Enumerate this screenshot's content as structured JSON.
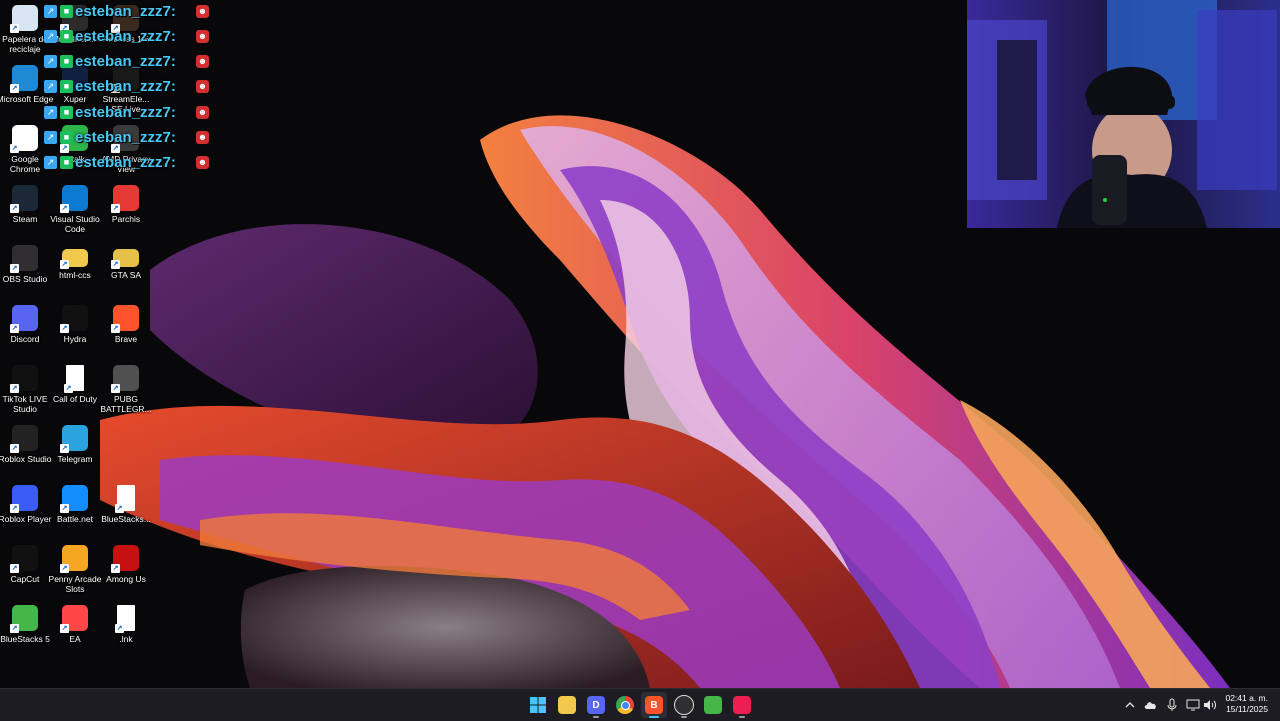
{
  "desktop": {
    "icons": [
      {
        "label": "Papelera de reciclaje",
        "icon": "recycle-bin-icon",
        "color": "#d8e6f3"
      },
      {
        "label": "Multi-Insta...",
        "icon": "multi-instance-icon",
        "color": "#2b2b2b"
      },
      {
        "label": "Andreas 1.6",
        "icon": "andreas-icon",
        "color": "#3a2a20"
      },
      {
        "label": "Microsoft Edge",
        "icon": "edge-icon",
        "color": "#1e8ad6"
      },
      {
        "label": "Xuper",
        "icon": "xuper-icon",
        "color": "#102040"
      },
      {
        "label": "StreamEle... SE.Live",
        "icon": "streamelements-icon",
        "color": "#1a1a1a"
      },
      {
        "label": "Google Chrome",
        "icon": "chrome-icon",
        "color": "#ffffff"
      },
      {
        "label": "Gtalk",
        "icon": "gtalk-icon",
        "color": "#2db54a"
      },
      {
        "label": "AMD Privacy View",
        "icon": "amd-privacy-icon",
        "color": "#3a3a3a"
      },
      {
        "label": "Steam",
        "icon": "steam-icon",
        "color": "#1b2838"
      },
      {
        "label": "Visual Studio Code",
        "icon": "vscode-icon",
        "color": "#0b7ad1"
      },
      {
        "label": "Parchis",
        "icon": "parchis-icon",
        "color": "#e53935"
      },
      {
        "label": "OBS Studio",
        "icon": "obs-icon",
        "color": "#302e31"
      },
      {
        "label": "html-ccs",
        "icon": "folder-icon",
        "color": "#f2c94c"
      },
      {
        "label": "GTA SA",
        "icon": "folder-icon",
        "color": "#e7c04a"
      },
      {
        "label": "Discord",
        "icon": "discord-icon",
        "color": "#5865f2"
      },
      {
        "label": "Hydra",
        "icon": "hydra-icon",
        "color": "#111111"
      },
      {
        "label": "Brave",
        "icon": "brave-icon",
        "color": "#fb542b"
      },
      {
        "label": "TikTok LIVE Studio",
        "icon": "tiktok-icon",
        "color": "#111111"
      },
      {
        "label": "Call of Duty",
        "icon": "file-icon",
        "color": "#ffffff"
      },
      {
        "label": "PUBG BATTLEGR...",
        "icon": "pubg-icon",
        "color": "#505050"
      },
      {
        "label": "Roblox Studio",
        "icon": "roblox-studio-icon",
        "color": "#222222"
      },
      {
        "label": "Telegram",
        "icon": "telegram-icon",
        "color": "#2aa3df"
      },
      {
        "label": "",
        "icon": "empty",
        "color": "transparent"
      },
      {
        "label": "Roblox Player",
        "icon": "roblox-player-icon",
        "color": "#3b5bf5"
      },
      {
        "label": "Battle.net",
        "icon": "battlenet-icon",
        "color": "#148eff"
      },
      {
        "label": "BlueStacks...",
        "icon": "file-icon",
        "color": "#ffffff"
      },
      {
        "label": "CapCut",
        "icon": "capcut-icon",
        "color": "#111111"
      },
      {
        "label": "Penny Arcade Slots",
        "icon": "penny-arcade-icon",
        "color": "#f6a623"
      },
      {
        "label": "Among Us",
        "icon": "among-us-icon",
        "color": "#c51111"
      },
      {
        "label": "BlueStacks 5",
        "icon": "bluestacks-icon",
        "color": "#45b649"
      },
      {
        "label": "EA",
        "icon": "ea-icon",
        "color": "#ff4747"
      },
      {
        "label": ".lnk",
        "icon": "file-icon",
        "color": "#ffffff"
      }
    ]
  },
  "chat": {
    "messages": [
      {
        "user": "esteban_zzz7:"
      },
      {
        "user": "esteban_zzz7:"
      },
      {
        "user": "esteban_zzz7:"
      },
      {
        "user": "esteban_zzz7:"
      },
      {
        "user": "esteban_zzz7:"
      },
      {
        "user": "esteban_zzz7:"
      },
      {
        "user": "esteban_zzz7:"
      }
    ],
    "name_color": "#48c9f5"
  },
  "webcam": {
    "icon": "webcam-feed"
  },
  "taskbar": {
    "apps": [
      {
        "name": "start-button",
        "icon": "windows-icon",
        "color": "#3aa0ff",
        "glyph": "",
        "running": false,
        "active": false
      },
      {
        "name": "file-explorer-button",
        "icon": "folder-icon",
        "color": "#f2c94c",
        "glyph": "",
        "running": false,
        "active": false
      },
      {
        "name": "discord-button",
        "icon": "discord-icon",
        "color": "#5865f2",
        "glyph": "D",
        "running": true,
        "active": false
      },
      {
        "name": "chrome-button",
        "icon": "chrome-icon",
        "color": "#e8453c",
        "glyph": "",
        "running": false,
        "active": false
      },
      {
        "name": "brave-button",
        "icon": "brave-icon",
        "color": "#fb542b",
        "glyph": "B",
        "running": true,
        "active": true
      },
      {
        "name": "obs-button",
        "icon": "obs-icon",
        "color": "#302e31",
        "glyph": "",
        "running": true,
        "active": false
      },
      {
        "name": "bluestacks-button",
        "icon": "bluestacks-icon",
        "color": "#45b649",
        "glyph": "",
        "running": false,
        "active": false
      },
      {
        "name": "tiktok-live-button",
        "icon": "tiktok-icon",
        "color": "#ee1d52",
        "glyph": "",
        "running": true,
        "active": false
      }
    ],
    "tray": {
      "icons": [
        "chevron-up-icon",
        "cloud-icon",
        "microphone-icon",
        "monitor-icon",
        "volume-icon"
      ],
      "time": "02:41 a. m.",
      "date": "15/11/2025"
    }
  }
}
